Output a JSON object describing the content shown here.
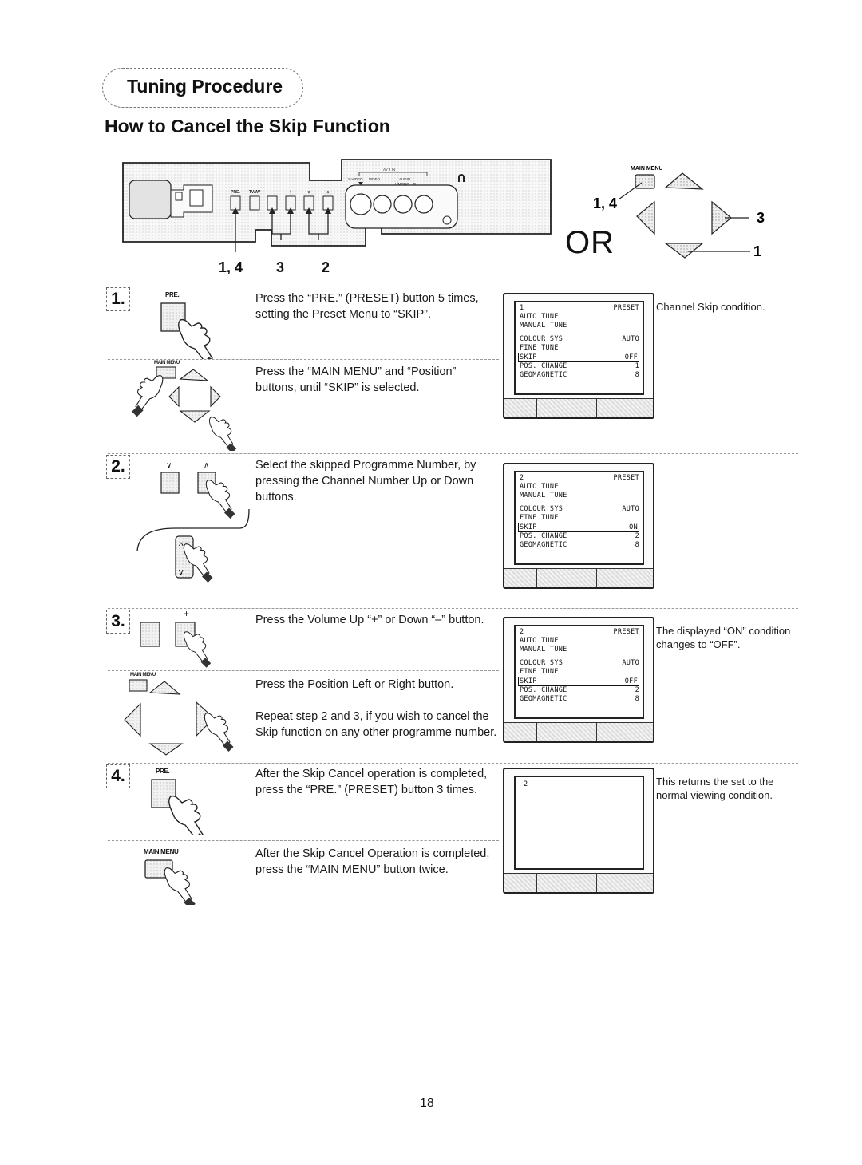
{
  "header": {
    "section": "Tuning Procedure",
    "title": "How to Cancel the Skip Function"
  },
  "front_panel": {
    "button_labels": [
      "PRE.",
      "TV/AV",
      "–",
      "+",
      "∨",
      "∧"
    ],
    "av_group_label": "AV 2 IN",
    "jack_labels": [
      "S-VIDEO",
      "VIDEO",
      "AUDIO",
      "L/MONO – R"
    ],
    "callouts": [
      "1, 4",
      "3",
      "2"
    ]
  },
  "remote": {
    "main_menu_label": "MAIN MENU",
    "or_label": "OR",
    "callouts": {
      "main_menu": "1, 4",
      "right": "3",
      "down": "1"
    }
  },
  "steps": [
    {
      "number": "1.",
      "icon_label": "PRE.",
      "instructions": [
        "Press the “PRE.” (PRESET) button 5 times, setting the Preset Menu to “SKIP”.",
        "Press the “MAIN MENU” and “Position” buttons, until “SKIP” is selected."
      ],
      "secondary_icon_label": "MAIN MENU",
      "screen": {
        "rows": [
          {
            "left": "1",
            "right": "PRESET"
          },
          {
            "left": "AUTO TUNE",
            "right": ""
          },
          {
            "left": "MANUAL TUNE",
            "right": ""
          },
          {
            "left": "COLOUR SYS",
            "right": "AUTO"
          },
          {
            "left": "FINE TUNE",
            "right": ""
          },
          {
            "left": "SKIP",
            "right": "OFF",
            "highlight": true
          },
          {
            "left": "POS. CHANGE",
            "right": "1"
          },
          {
            "left": "GEOMAGNETIC",
            "right": "8"
          }
        ]
      },
      "note": "Channel Skip condition."
    },
    {
      "number": "2.",
      "icon_labels": [
        "∨",
        "∧"
      ],
      "instructions": [
        "Select the skipped Programme Number, by pressing the Channel Number Up or Down buttons."
      ],
      "screen": {
        "rows": [
          {
            "left": "2",
            "right": "PRESET"
          },
          {
            "left": "AUTO TUNE",
            "right": ""
          },
          {
            "left": "MANUAL TUNE",
            "right": ""
          },
          {
            "left": "COLOUR SYS",
            "right": "AUTO"
          },
          {
            "left": "FINE TUNE",
            "right": ""
          },
          {
            "left": "SKIP",
            "right": "ON",
            "highlight": true
          },
          {
            "left": "POS. CHANGE",
            "right": "2"
          },
          {
            "left": "GEOMAGNETIC",
            "right": "8"
          }
        ]
      },
      "note": ""
    },
    {
      "number": "3.",
      "icon_labels": [
        "—",
        "+"
      ],
      "instructions": [
        "Press the Volume Up “+” or Down “–” button.",
        "Press the Position Left or Right button.",
        "Repeat step 2 and 3, if you wish to cancel the Skip function on any other programme number."
      ],
      "secondary_icon_label": "MAIN MENU",
      "screen": {
        "rows": [
          {
            "left": "2",
            "right": "PRESET"
          },
          {
            "left": "AUTO TUNE",
            "right": ""
          },
          {
            "left": "MANUAL TUNE",
            "right": ""
          },
          {
            "left": "COLOUR SYS",
            "right": "AUTO"
          },
          {
            "left": "FINE TUNE",
            "right": ""
          },
          {
            "left": "SKIP",
            "right": "OFF",
            "highlight": true
          },
          {
            "left": "POS. CHANGE",
            "right": "2"
          },
          {
            "left": "GEOMAGNETIC",
            "right": "8"
          }
        ]
      },
      "note": "The displayed “ON” condition changes to “OFF”."
    },
    {
      "number": "4.",
      "icon_label": "PRE.",
      "instructions": [
        "After the Skip Cancel operation is completed, press the “PRE.” (PRESET) button 3 times.",
        "After the Skip Cancel Operation is completed, press the “MAIN MENU” button twice."
      ],
      "secondary_icon_label": "MAIN MENU",
      "screen": {
        "channel": "2"
      },
      "note": "This returns the set to the normal viewing condition."
    }
  ],
  "footer": {
    "page_number": "18"
  }
}
